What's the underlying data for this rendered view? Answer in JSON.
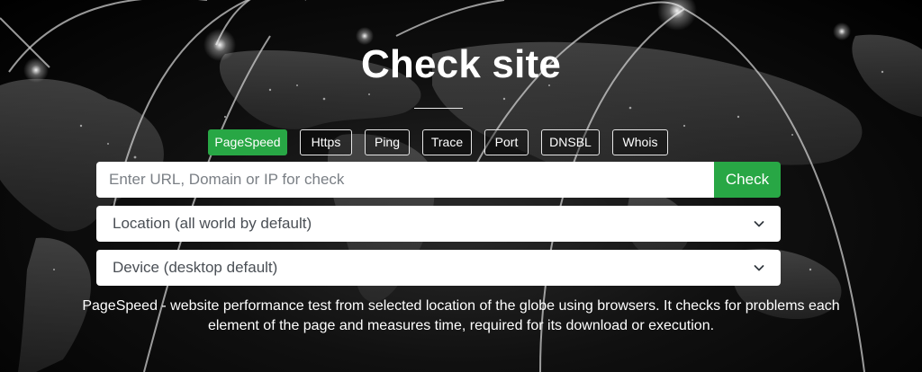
{
  "hero": {
    "title": "Check site"
  },
  "tabs": [
    {
      "label": "PageSpeed",
      "active": true
    },
    {
      "label": "Https",
      "active": false
    },
    {
      "label": "Ping",
      "active": false
    },
    {
      "label": "Trace",
      "active": false
    },
    {
      "label": "Port",
      "active": false
    },
    {
      "label": "DNSBL",
      "active": false
    },
    {
      "label": "Whois",
      "active": false
    }
  ],
  "search": {
    "placeholder": "Enter URL, Domain or IP for check",
    "value": "",
    "button_label": "Check"
  },
  "location_select": {
    "selected": "Location (all world by default)"
  },
  "device_select": {
    "selected": "Device (desktop default)"
  },
  "description": "PageSpeed - website performance test from selected location of the globe using browsers. It checks for problems each element of the page and measures time, required for its download or execution.",
  "colors": {
    "accent": "#28a745",
    "background": "#000000",
    "text": "#ffffff"
  },
  "icons": {
    "select_chevron": "chevron-down-icon"
  }
}
